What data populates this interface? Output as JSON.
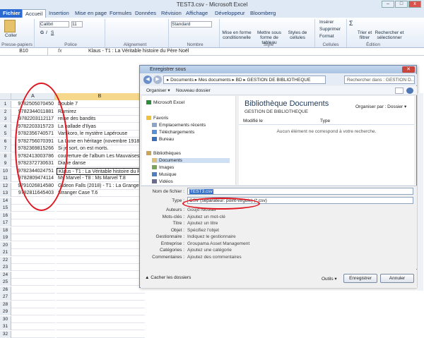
{
  "window": {
    "title": "TEST3.csv - Microsoft Excel",
    "minimize": "–",
    "maximize": "□",
    "close": "x"
  },
  "ribbon_tabs": [
    "Fichier",
    "Accueil",
    "Insertion",
    "Mise en page",
    "Formules",
    "Données",
    "Révision",
    "Affichage",
    "Développeur",
    "Bloomberg"
  ],
  "ribbon": {
    "paste_label": "Coller",
    "font_name": "Calibri",
    "font_size": "11",
    "bold": "G",
    "italic": "I",
    "underline": "S",
    "number_format": "Standard",
    "conditional": "Mise en forme conditionnelle",
    "table_format": "Mettre sous forme de tableau",
    "cell_styles": "Styles de cellules",
    "insert": "Insérer",
    "delete": "Supprimer",
    "format": "Format",
    "sort": "Trier et filtrer",
    "find": "Rechercher et sélectionner",
    "sigma": "Σ",
    "groups": {
      "clipboard": "Presse-papiers",
      "font": "Police",
      "alignment": "Alignement",
      "number": "Nombre",
      "style": "Style",
      "cells": "Cellules",
      "editing": "Édition"
    }
  },
  "formula_bar": {
    "name_box": "B10",
    "fx": "fx",
    "content": "Klaus - T1 : La Véritable histoire du Père Noël"
  },
  "sheet": {
    "col_a": "A",
    "col_b": "B",
    "rows": [
      {
        "n": "1",
        "a": "9782505070450",
        "b": "Double 7"
      },
      {
        "n": "2",
        "a": "9782344011881",
        "b": "Ramirez"
      },
      {
        "n": "3",
        "a": "9782203112117",
        "b": "reine des bandits"
      },
      {
        "n": "4",
        "a": "9782203315723",
        "b": "La ballade d'Ilyas"
      },
      {
        "n": "5",
        "a": "9782356740571",
        "b": "Vanikoro, le mystère Lapérouse"
      },
      {
        "n": "6",
        "a": "9782756070391",
        "b": "La Lune en héritage (novembre 1918)"
      },
      {
        "n": "7",
        "a": "9782369815266",
        "b": "Si je sort, on est morts."
      },
      {
        "n": "8",
        "a": "9782413003786",
        "b": "couverture de l'album Les Mauvaises herb"
      },
      {
        "n": "9",
        "a": "9782372730631",
        "b": "Diane danse"
      },
      {
        "n": "10",
        "a": "9782344024751",
        "b": "Klaus - T1 : La Véritable histoire du Père N"
      },
      {
        "n": "11",
        "a": "9782809474114",
        "b": "Ms Marvel - T8 : Ms Marvel T.8"
      },
      {
        "n": "12",
        "a": "9791026814580",
        "b": "Gideon Falls (2018) - T1 : La Grange noire"
      },
      {
        "n": "13",
        "a": "9782811645403",
        "b": "Stranger Case T.6"
      },
      {
        "n": "14",
        "a": "",
        "b": ""
      },
      {
        "n": "15",
        "a": "",
        "b": ""
      },
      {
        "n": "16",
        "a": "",
        "b": ""
      },
      {
        "n": "17",
        "a": "",
        "b": ""
      },
      {
        "n": "18",
        "a": "",
        "b": ""
      },
      {
        "n": "19",
        "a": "",
        "b": ""
      },
      {
        "n": "20",
        "a": "",
        "b": ""
      },
      {
        "n": "21",
        "a": "",
        "b": ""
      },
      {
        "n": "22",
        "a": "",
        "b": ""
      },
      {
        "n": "23",
        "a": "",
        "b": ""
      },
      {
        "n": "24",
        "a": "",
        "b": ""
      },
      {
        "n": "25",
        "a": "",
        "b": ""
      },
      {
        "n": "26",
        "a": "",
        "b": ""
      },
      {
        "n": "27",
        "a": "",
        "b": ""
      },
      {
        "n": "28",
        "a": "",
        "b": ""
      },
      {
        "n": "29",
        "a": "",
        "b": ""
      },
      {
        "n": "30",
        "a": "",
        "b": ""
      },
      {
        "n": "31",
        "a": "",
        "b": ""
      },
      {
        "n": "32",
        "a": "",
        "b": ""
      }
    ]
  },
  "dialog": {
    "title": "Enregistrer sous",
    "close": "✕",
    "path": "▸ Documents ▸ Mes documents ▸ BD ▸ GESTION DE BIBLIOTHEQUE",
    "search": "Rechercher dans : GESTION D...",
    "organize": "Organiser ▾",
    "new_folder": "Nouveau dossier",
    "nav": {
      "excel": "Microsoft Excel",
      "favorites": "Favoris",
      "recent": "Emplacements récents",
      "downloads": "Téléchargements",
      "desktop": "Bureau",
      "libraries": "Bibliothèques",
      "documents": "Documents",
      "images": "Images",
      "music": "Musique",
      "videos": "Vidéos"
    },
    "library_title": "Bibliothèque Documents",
    "library_sub": "GESTION DE BIBLIOTHEQUE",
    "organize_by": "Organiser par :",
    "organize_val": "Dossier ▾",
    "col_name": "Modifié le",
    "col_type": "Type",
    "empty": "Aucun élément ne correspond à votre recherche.",
    "filename_label": "Nom de fichier :",
    "filename": "TEST3.csv",
    "type_label": "Type :",
    "type": "CSV (séparateur: point-virgule) (*.csv)",
    "meta": [
      {
        "label": "Auteurs :",
        "value": "Goujo Nicolas"
      },
      {
        "label": "Mots-clés :",
        "value": "Ajoutez un mot-clé"
      },
      {
        "label": "Titre :",
        "value": "Ajoutez un titre"
      },
      {
        "label": "Objet :",
        "value": "Spécifiez l'objet"
      },
      {
        "label": "Gestionnaire :",
        "value": "Indiquez le gestionnaire"
      },
      {
        "label": "Entreprise :",
        "value": "Groupama Asset Management"
      },
      {
        "label": "Catégories :",
        "value": "Ajoutez une catégorie"
      },
      {
        "label": "Commentaires :",
        "value": "Ajoutez des commentaires"
      }
    ],
    "hide_folders": "Cacher les dossiers",
    "tools": "Outils",
    "save": "Enregistrer",
    "cancel": "Annuler"
  }
}
